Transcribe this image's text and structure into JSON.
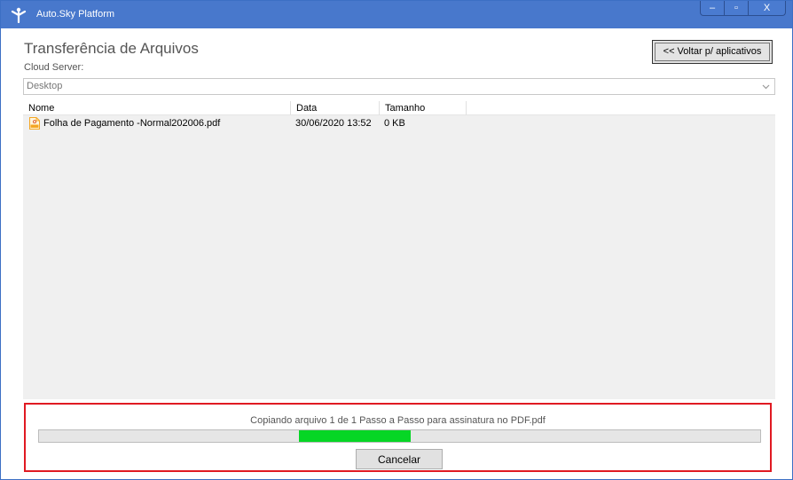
{
  "window": {
    "title": "Auto.Sky Platform",
    "controls": {
      "minimize": "–",
      "maximize": "▫",
      "close": "X"
    }
  },
  "page": {
    "heading": "Transferência de Arquivos",
    "back_button": "<< Voltar p/ aplicativos",
    "server_label": "Cloud Server:",
    "server_value": "Desktop"
  },
  "file_list": {
    "columns": [
      "Nome",
      "Data",
      "Tamanho"
    ],
    "rows": [
      {
        "name": "Folha de Pagamento -Normal202006.pdf",
        "date": "30/06/2020 13:52",
        "size": "0 KB",
        "icon": "pdf-file-icon"
      }
    ]
  },
  "transfer": {
    "status": "Copiando arquivo 1 de 1 Passo a Passo para assinatura no PDF.pdf",
    "cancel_button": "Cancelar",
    "progress_indicator": {
      "start_fraction": 0.36,
      "end_fraction": 0.515
    }
  },
  "colors": {
    "titlebar": "#4878cc",
    "progress": "#06d625",
    "highlight_border": "#e01a22",
    "pdf_icon": "#f4a623"
  }
}
